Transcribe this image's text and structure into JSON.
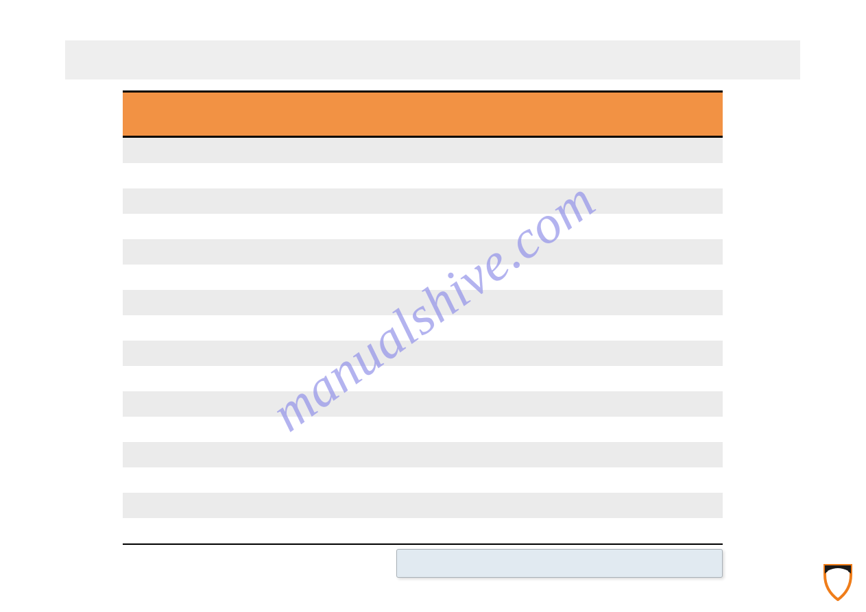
{
  "watermark_text": "manualshive.com",
  "table": {
    "header_color": "#f29244",
    "row_count_pairs": 8
  },
  "logo": {
    "name": "shield-logo",
    "colors": {
      "top": "#1a1a1a",
      "bottom_outline": "#ef7d1a",
      "inner": "#ffffff"
    }
  }
}
